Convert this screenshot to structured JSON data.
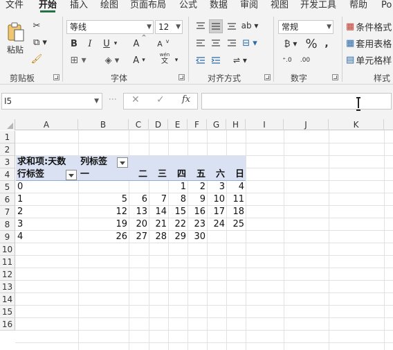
{
  "ribbon": {
    "tabs": [
      "文件",
      "开始",
      "插入",
      "绘图",
      "页面布局",
      "公式",
      "数据",
      "审阅",
      "视图",
      "开发工具",
      "帮助",
      "Po"
    ],
    "active_tab": "开始",
    "clipboard": {
      "paste_label": "粘贴",
      "group_label": "剪贴板"
    },
    "font": {
      "font_name": "等线",
      "font_size": "12",
      "bold": "B",
      "italic": "I",
      "underline": "U",
      "grow": "A",
      "shrink": "A",
      "font_color": "A",
      "phonetic": "wén",
      "phonetic_char": "文",
      "group_label": "字体"
    },
    "alignment": {
      "group_label": "对齐方式"
    },
    "number": {
      "format": "常规",
      "percent": "%",
      "group_label": "数字"
    },
    "styles": {
      "conditional": "条件格式",
      "table": "套用表格",
      "cell": "单元格样",
      "group_label": "样式"
    }
  },
  "formula_bar": {
    "name_box": "I5",
    "fx": "fx",
    "cancel": "✕",
    "enter": "✓",
    "formula": ""
  },
  "grid": {
    "columns": [
      "A",
      "B",
      "C",
      "D",
      "E",
      "F",
      "G",
      "H",
      "I",
      "J",
      "K"
    ],
    "rows": [
      "1",
      "2",
      "3",
      "4",
      "5",
      "6",
      "7",
      "8",
      "9",
      "10",
      "11",
      "12",
      "13",
      "14",
      "15",
      "16"
    ]
  },
  "pivot": {
    "value_field": "求和项:天数",
    "column_label": "列标签",
    "row_label": "行标签",
    "column_headers": [
      "一",
      "二",
      "三",
      "四",
      "五",
      "六",
      "日"
    ],
    "rows": [
      {
        "label": "0",
        "values": [
          "",
          "",
          "",
          "1",
          "2",
          "3",
          "4"
        ]
      },
      {
        "label": "1",
        "values": [
          "5",
          "6",
          "7",
          "8",
          "9",
          "10",
          "11"
        ]
      },
      {
        "label": "2",
        "values": [
          "12",
          "13",
          "14",
          "15",
          "16",
          "17",
          "18"
        ]
      },
      {
        "label": "3",
        "values": [
          "19",
          "20",
          "21",
          "22",
          "23",
          "24",
          "25"
        ]
      },
      {
        "label": "4",
        "values": [
          "26",
          "27",
          "28",
          "29",
          "30",
          "",
          ""
        ]
      }
    ]
  },
  "colors": {
    "accent": "#217346",
    "pivot_header": "#d9e1f2",
    "pivot_border": "#8ea9db"
  }
}
